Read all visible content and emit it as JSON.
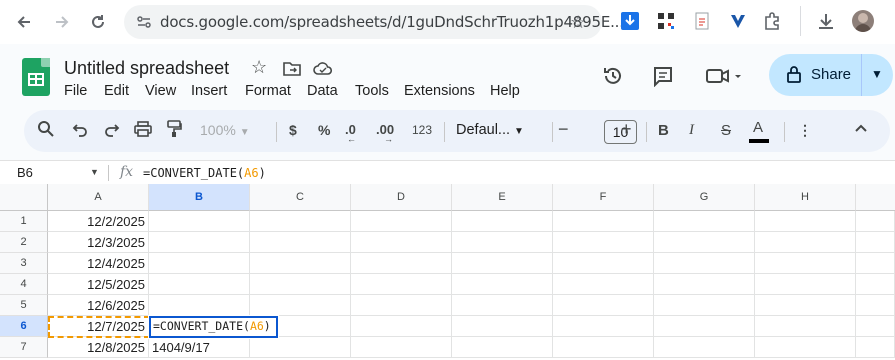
{
  "browser": {
    "back_icon": "arrow-left",
    "forward_icon": "arrow-right",
    "reload_icon": "refresh",
    "url": "docs.google.com/spreadsheets/d/1guDndSchrTruozh1p4895E..."
  },
  "doc": {
    "title": "Untitled spreadsheet",
    "menu": [
      "File",
      "Edit",
      "View",
      "Insert",
      "Format",
      "Data",
      "Tools",
      "Extensions",
      "Help"
    ],
    "share_label": "Share"
  },
  "toolbar": {
    "zoom": "100%",
    "currency": "$",
    "percent": "%",
    "dec_decrease": ".0",
    "dec_increase": ".00",
    "number_format": "123",
    "font": "Defaul...",
    "font_size": "10",
    "bold": "B",
    "italic": "I",
    "strike": "S",
    "text_color": "A"
  },
  "formula_bar": {
    "name_box": "B6",
    "fx": "fx",
    "formula_prefix": "=CONVERT_DATE(",
    "formula_ref": "A6",
    "formula_suffix": ")"
  },
  "sheet": {
    "columns": [
      "A",
      "B",
      "C",
      "D",
      "E",
      "F",
      "G",
      "H"
    ],
    "selected_column": "B",
    "selected_row": "6",
    "rows": [
      {
        "num": "1",
        "a": "12/2/2025",
        "b": ""
      },
      {
        "num": "2",
        "a": "12/3/2025",
        "b": ""
      },
      {
        "num": "3",
        "a": "12/4/2025",
        "b": ""
      },
      {
        "num": "4",
        "a": "12/5/2025",
        "b": ""
      },
      {
        "num": "5",
        "a": "12/6/2025",
        "b": ""
      },
      {
        "num": "6",
        "a": "12/7/2025",
        "b": ""
      },
      {
        "num": "7",
        "a": "12/8/2025",
        "b": "1404/9/17"
      }
    ],
    "active_cell": {
      "prefix": "=CONVERT_DATE(",
      "ref": "A6",
      "suffix": ")"
    }
  }
}
